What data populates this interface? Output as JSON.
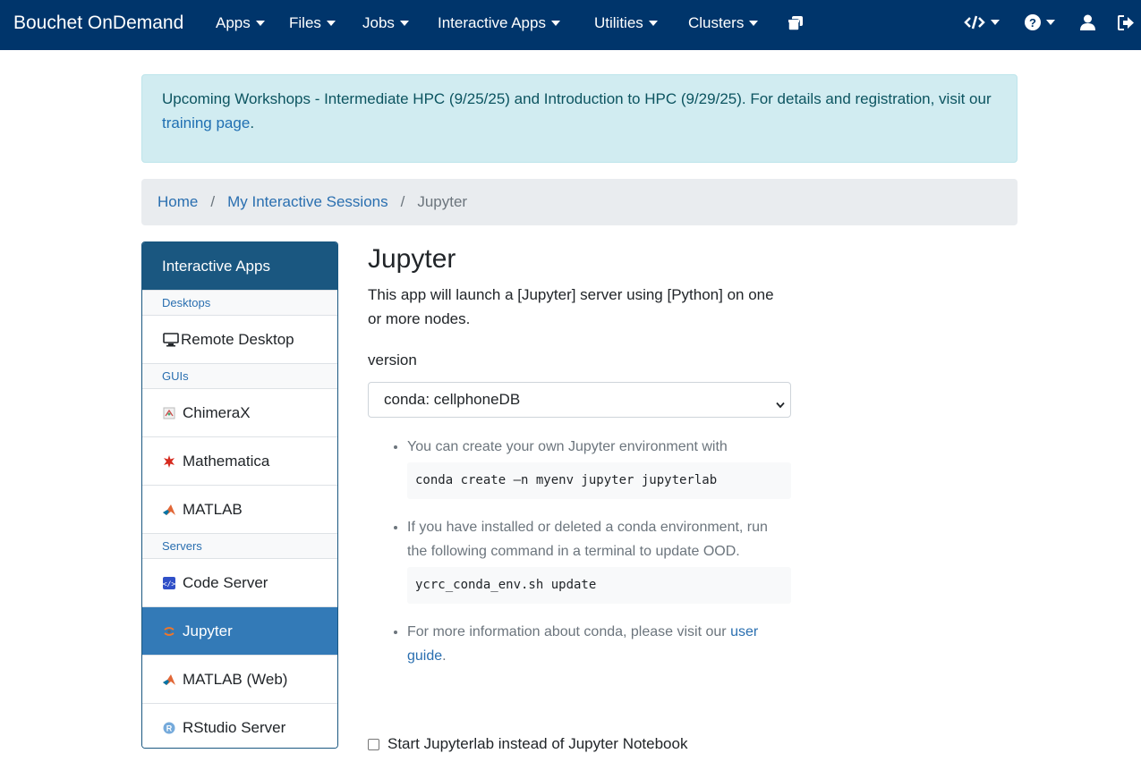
{
  "navbar": {
    "brand": "Bouchet OnDemand",
    "menus": [
      "Apps",
      "Files",
      "Jobs",
      "Interactive Apps",
      "Utilities",
      "Clusters"
    ]
  },
  "alert": {
    "text": "Upcoming Workshops - Intermediate HPC (9/25/25) and Introduction to HPC (9/29/25). For details and registration, visit our ",
    "link": "training page",
    "suffix": "."
  },
  "breadcrumb": {
    "home": "Home",
    "sessions": "My Interactive Sessions",
    "current": "Jupyter"
  },
  "sidebar": {
    "header": "Interactive Apps",
    "groups": {
      "desktops": "Desktops",
      "guis": "GUIs",
      "servers": "Servers"
    },
    "items": {
      "remote_desktop": "Remote Desktop",
      "chimerax": "ChimeraX",
      "mathematica": "Mathematica",
      "matlab": "MATLAB",
      "code_server": "Code Server",
      "jupyter": "Jupyter",
      "matlab_web": "MATLAB (Web)",
      "rstudio": "RStudio Server"
    }
  },
  "main": {
    "title": "Jupyter",
    "description": "This app will launch a [Jupyter] server using [Python] on one or more nodes.",
    "version_label": "version",
    "version_value": "conda: cellphoneDB",
    "help1": "You can create your own Jupyter environment with",
    "code1": "conda create —n myenv jupyter jupyterlab",
    "help2": "If you have installed or deleted a conda environment, run the following command in a terminal to update OOD.",
    "code2": "ycrc_conda_env.sh update",
    "help3": "For more information about conda, please visit our ",
    "help3_link": "user guide",
    "help3_suffix": ".",
    "checkbox_label": "Start Jupyterlab instead of Jupyter Notebook"
  },
  "colors": {
    "navbar": "#00356b",
    "sidebar_header": "#1a5780",
    "active_item": "#337ab7",
    "alert_bg": "#d1ecf1"
  }
}
